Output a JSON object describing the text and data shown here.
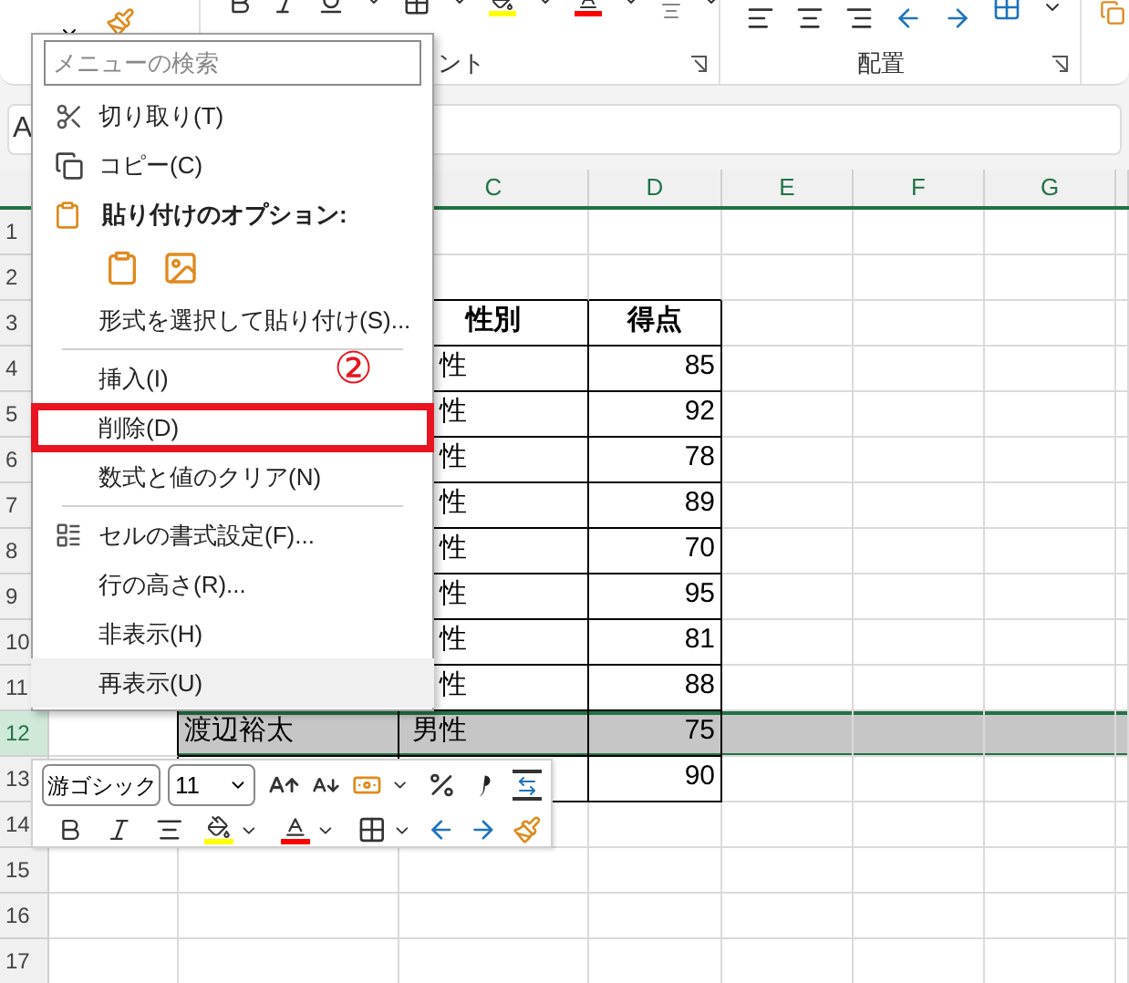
{
  "ribbon": {
    "groups": [
      {
        "label": "ント"
      },
      {
        "label": "配置"
      }
    ]
  },
  "formula_bar": {
    "name_box": "A"
  },
  "grid": {
    "column_headers": [
      "C",
      "D",
      "E",
      "F",
      "G"
    ],
    "rows": [
      {
        "number": "1",
        "selected": false,
        "table": false
      },
      {
        "number": "2",
        "selected": false,
        "table": false
      },
      {
        "number": "3",
        "selected": false,
        "table": true,
        "header": true,
        "c": "性別",
        "d": "得点"
      },
      {
        "number": "4",
        "selected": false,
        "table": true,
        "header": false,
        "c": "性",
        "d": "85"
      },
      {
        "number": "5",
        "selected": false,
        "table": true,
        "header": false,
        "c": "性",
        "d": "92"
      },
      {
        "number": "6",
        "selected": false,
        "table": true,
        "header": false,
        "c": "性",
        "d": "78"
      },
      {
        "number": "7",
        "selected": false,
        "table": true,
        "header": false,
        "c": "性",
        "d": "89"
      },
      {
        "number": "8",
        "selected": false,
        "table": true,
        "header": false,
        "c": "性",
        "d": "70"
      },
      {
        "number": "9",
        "selected": false,
        "table": true,
        "header": false,
        "c": "性",
        "d": "95"
      },
      {
        "number": "10",
        "selected": false,
        "table": true,
        "header": false,
        "c": "性",
        "d": "81"
      },
      {
        "number": "11",
        "selected": false,
        "table": true,
        "header": false,
        "c": "性",
        "d": "88"
      },
      {
        "number": "12",
        "selected": true,
        "table": true,
        "header": false,
        "b": "渡辺裕太",
        "c": "男性",
        "d": "75"
      },
      {
        "number": "13",
        "selected": false,
        "table": true,
        "header": false,
        "d": "90"
      },
      {
        "number": "14",
        "selected": false,
        "table": false
      },
      {
        "number": "15",
        "selected": false,
        "table": false
      },
      {
        "number": "16",
        "selected": false,
        "table": false
      },
      {
        "number": "17",
        "selected": false,
        "table": false
      }
    ]
  },
  "context_menu": {
    "search": {
      "placeholder": "メニューの検索"
    },
    "annotation": "②",
    "items": [
      {
        "kind": "item",
        "label": "切り取り(T)",
        "highlighted": false,
        "marked": false
      },
      {
        "kind": "item",
        "label": "コピー(C)",
        "highlighted": false,
        "marked": false
      },
      {
        "kind": "heading",
        "label": "貼り付けのオプション:"
      },
      {
        "kind": "paste_buttons"
      },
      {
        "kind": "item",
        "label": "形式を選択して貼り付け(S)...",
        "highlighted": false,
        "marked": false
      },
      {
        "kind": "separator"
      },
      {
        "kind": "item",
        "label": "挿入(I)",
        "highlighted": false,
        "marked": false
      },
      {
        "kind": "item",
        "label": "削除(D)",
        "highlighted": false,
        "marked": true
      },
      {
        "kind": "item",
        "label": "数式と値のクリア(N)",
        "highlighted": false,
        "marked": false
      },
      {
        "kind": "separator"
      },
      {
        "kind": "item",
        "label": "セルの書式設定(F)...",
        "highlighted": false,
        "marked": false
      },
      {
        "kind": "item",
        "label": "行の高さ(R)...",
        "highlighted": false,
        "marked": false
      },
      {
        "kind": "item",
        "label": "非表示(H)",
        "highlighted": false,
        "marked": false
      },
      {
        "kind": "item",
        "label": "再表示(U)",
        "highlighted": true,
        "marked": false
      }
    ]
  },
  "mini_toolbar": {
    "font": "游ゴシック",
    "size": "11"
  }
}
